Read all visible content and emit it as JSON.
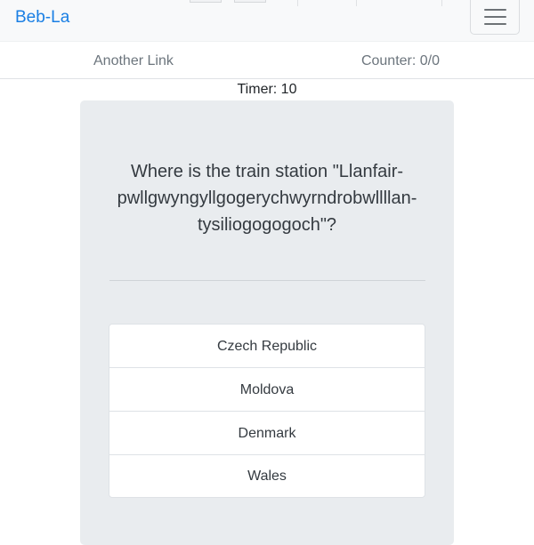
{
  "navbar": {
    "brand": "Beb-La",
    "toggler_icon": "hamburger-menu-icon"
  },
  "subnav": {
    "link_label": "Another Link",
    "counter_text": "Counter: 0/0"
  },
  "quiz": {
    "timer_text": "Timer: 10",
    "question": "Where is the train station \"Llanfair-pwllgwyngyllgogerychwyrndrobwllllan-tysiliogogogoch\"?",
    "answers": [
      {
        "label": "Czech Republic"
      },
      {
        "label": "Moldova"
      },
      {
        "label": "Denmark"
      },
      {
        "label": "Wales"
      }
    ]
  },
  "colors": {
    "brand": "#1a7fe4",
    "navbar_bg": "#f8f9fa",
    "card_bg": "#e9ecef",
    "muted_text": "#6c757d"
  }
}
